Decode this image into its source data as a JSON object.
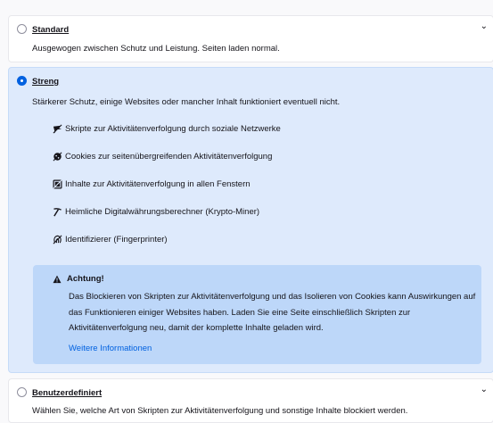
{
  "standard": {
    "title": "Standard",
    "description": "Ausgewogen zwischen Schutz und Leistung. Seiten laden normal.",
    "selected": false,
    "chevron_icon": "chevron-down-icon"
  },
  "strict": {
    "title": "Streng",
    "description": "Stärkerer Schutz, einige Websites oder mancher Inhalt funktioniert eventuell nicht.",
    "selected": true,
    "features": [
      {
        "icon": "social-tracker-icon",
        "label": "Skripte zur Aktivitätenverfolgung durch soziale Netzwerke"
      },
      {
        "icon": "cookie-icon",
        "label": "Cookies zur seitenübergreifenden Aktivitätenverfolgung"
      },
      {
        "icon": "tracking-content-icon",
        "label": "Inhalte zur Aktivitätenverfolgung in allen Fenstern"
      },
      {
        "icon": "cryptominer-icon",
        "label": "Heimliche Digitalwährungsberechner (Krypto-Miner)"
      },
      {
        "icon": "fingerprinter-icon",
        "label": "Identifizierer (Fingerprinter)"
      }
    ],
    "warning": {
      "icon": "warning-icon",
      "title": "Achtung!",
      "body": "Das Blockieren von Skripten zur Aktivitätenverfolgung und das Isolieren von Cookies kann Auswirkungen auf das Funktionieren einiger Websites haben. Laden Sie eine Seite einschließlich Skripten zur Aktivitätenverfolgung neu, damit der komplette Inhalte geladen wird.",
      "link": "Weitere Informationen"
    }
  },
  "custom": {
    "title": "Benutzerdefiniert",
    "description": "Wählen Sie, welche Art von Skripten zur Aktivitätenverfolgung und sonstige Inhalte blockiert werden.",
    "selected": false,
    "chevron_icon": "chevron-down-icon"
  },
  "colors": {
    "accent": "#0061e0",
    "selected_card": "#deeafc",
    "warning_box": "#bdd7f9"
  }
}
